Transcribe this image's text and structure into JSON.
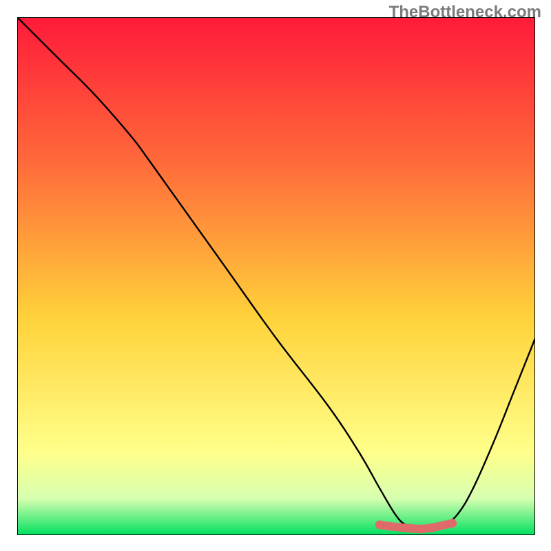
{
  "watermark": "TheBottleneck.com",
  "colors": {
    "grad_top": "#ff1a3a",
    "grad_upper": "#ff6a3a",
    "grad_mid": "#ffd23a",
    "grad_lower": "#ffff8a",
    "grad_base": "#d6ffb0",
    "grad_bottom": "#00e060",
    "curve": "#000000",
    "marker": "#e06a6a",
    "frame": "#000000"
  },
  "chart_data": {
    "type": "line",
    "title": "",
    "xlabel": "",
    "ylabel": "",
    "xlim": [
      0,
      100
    ],
    "ylim": [
      0,
      100
    ],
    "grid": false,
    "series": [
      {
        "name": "curve",
        "x": [
          0,
          8,
          15,
          22,
          25,
          30,
          40,
          50,
          60,
          66,
          70,
          73,
          75,
          78,
          80,
          82,
          85,
          88,
          92,
          96,
          100
        ],
        "y": [
          100,
          92,
          85,
          77,
          73,
          66,
          52,
          38,
          25,
          16,
          9,
          4,
          2,
          1,
          1,
          1.5,
          4,
          9,
          18,
          28,
          38
        ]
      }
    ],
    "markers": {
      "name": "min-plateau",
      "x": [
        70,
        72,
        74,
        76,
        78,
        80,
        84
      ],
      "y": [
        2.0,
        1.7,
        1.5,
        1.3,
        1.2,
        1.4,
        2.3
      ]
    }
  }
}
